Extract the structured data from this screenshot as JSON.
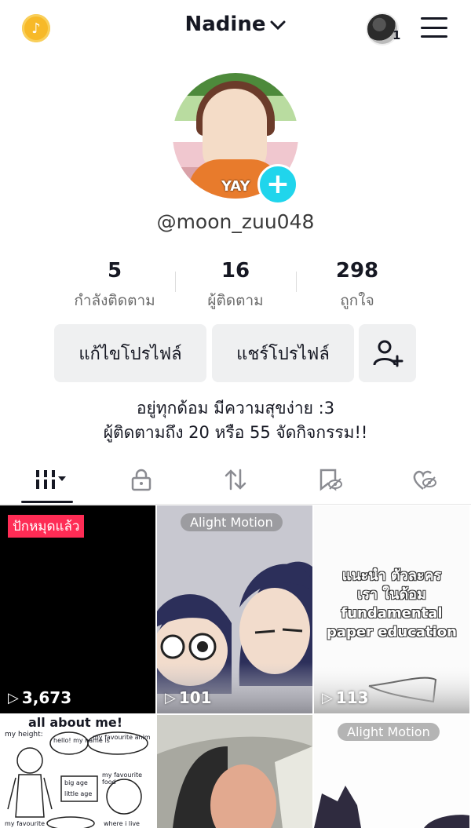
{
  "header": {
    "username": "Nadine",
    "notif_count": "1"
  },
  "profile": {
    "avatar_badge": "YAY",
    "handle": "@moon_zuu048"
  },
  "stats": [
    {
      "value": "5",
      "label": "กำลังติดตาม"
    },
    {
      "value": "16",
      "label": "ผู้ติดตาม"
    },
    {
      "value": "298",
      "label": "ถูกใจ"
    }
  ],
  "buttons": {
    "edit_profile": "แก้ไขโปรไฟล์",
    "share_profile": "แชร์โปรไฟล์"
  },
  "bio": [
    "อยู่ทุกด้อม มีความสุขง่าย :3",
    "ผู้ติดตามถึง 20 หรือ 55 จัดกิจกรรม!!"
  ],
  "tabs": [
    "videos-grid",
    "private",
    "reposts",
    "favorites",
    "liked"
  ],
  "videos": [
    {
      "views": "3,673",
      "pinned_label": "ปักหมุดแล้ว"
    },
    {
      "views": "101",
      "watermark": "Alight Motion"
    },
    {
      "views": "113",
      "overlay_lines": [
        "แนะนำ ตัวละคร",
        "เรา ในด้อม",
        "fundamental",
        "paper education"
      ]
    },
    {
      "overlay_title": "all about me!",
      "doodle_labels": [
        "my height:",
        "hello! my name is",
        "my favourite anim",
        "my favourite food",
        "big age",
        "little age",
        "my favourite",
        "where i live"
      ]
    },
    {},
    {
      "watermark": "Alight Motion"
    }
  ],
  "colors": {
    "accent_cyan": "#20d5ec",
    "pinned_red": "#fe2c55",
    "button_gray": "#eff0f1"
  }
}
